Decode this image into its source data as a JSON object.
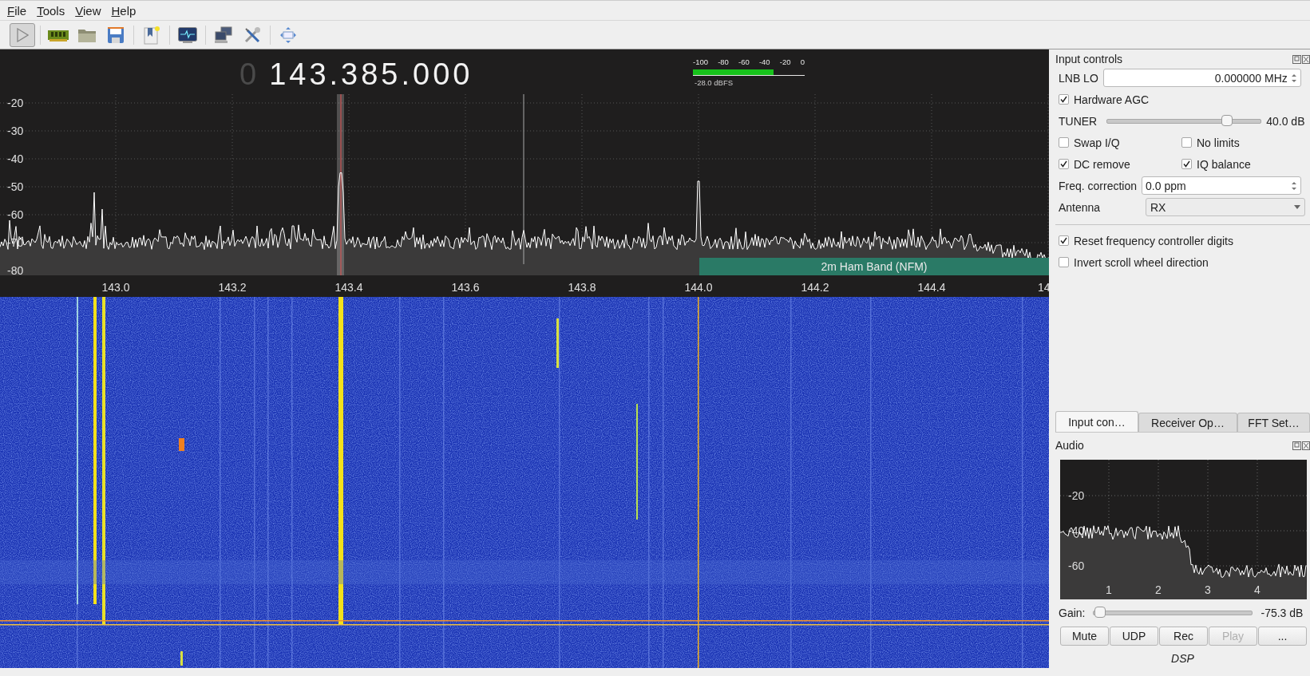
{
  "menu": [
    {
      "label": "File"
    },
    {
      "label": "Tools"
    },
    {
      "label": "View"
    },
    {
      "label": "Help"
    }
  ],
  "toolbar": [
    {
      "kind": "play",
      "selected": false
    },
    {
      "kind": "device"
    },
    {
      "kind": "open"
    },
    {
      "kind": "save"
    },
    {
      "kind": "bookmark"
    },
    {
      "kind": "monitor"
    },
    {
      "kind": "network"
    },
    {
      "kind": "tools"
    },
    {
      "kind": "fit"
    }
  ],
  "spectrum": {
    "frequency_prefix": "0",
    "frequency": "143.385.000",
    "meter": {
      "ticks": [
        "-100",
        "-80",
        "-60",
        "-40",
        "-20",
        "0"
      ],
      "level": 0.72,
      "reading": "-28.0 dBFS"
    },
    "y_labels": [
      "-20",
      "-30",
      "-40",
      "-50",
      "-60",
      "-70",
      "-80"
    ],
    "x_labels": [
      "143.0",
      "143.2",
      "143.4",
      "143.6",
      "143.8",
      "144.0",
      "144.2",
      "144.4",
      "14"
    ],
    "band": {
      "label": "2m Ham Band (NFM)"
    }
  },
  "input_controls": {
    "title": "Input controls",
    "lnb_lo": {
      "label": "LNB LO",
      "value": "0.000000 MHz"
    },
    "hardware_agc": {
      "label": "Hardware AGC",
      "checked": true
    },
    "tuner": {
      "label": "TUNER",
      "level": 0.78,
      "reading": "40.0 dB"
    },
    "options": [
      {
        "label": "Swap I/Q",
        "checked": false
      },
      {
        "label": "No limits",
        "checked": false
      },
      {
        "label": "DC remove",
        "checked": true
      },
      {
        "label": "IQ balance",
        "checked": true
      }
    ],
    "freq_correction": {
      "label": "Freq. correction",
      "value": "0.0 ppm"
    },
    "antenna": {
      "label": "Antenna",
      "value": "RX"
    },
    "extra_options": [
      {
        "label": "Reset frequency controller digits",
        "checked": true
      },
      {
        "label": "Invert scroll wheel direction",
        "checked": false
      }
    ]
  },
  "tabs": [
    {
      "label": "Input con…",
      "selected": true
    },
    {
      "label": "Receiver Op…",
      "selected": false
    },
    {
      "label": "FFT Set…",
      "selected": false
    }
  ],
  "audio": {
    "title": "Audio",
    "y_labels": [
      "-20",
      "-40",
      "-60"
    ],
    "x_labels": [
      "1",
      "2",
      "3",
      "4"
    ],
    "gain": {
      "label": "Gain:",
      "level": 0.04,
      "reading": "-75.3 dB"
    },
    "buttons": [
      {
        "label": "Mute",
        "disabled": false
      },
      {
        "label": "UDP",
        "disabled": false
      },
      {
        "label": "Rec",
        "disabled": false
      },
      {
        "label": "Play",
        "disabled": true
      },
      {
        "label": "...",
        "disabled": false
      }
    ],
    "footer": "DSP"
  }
}
